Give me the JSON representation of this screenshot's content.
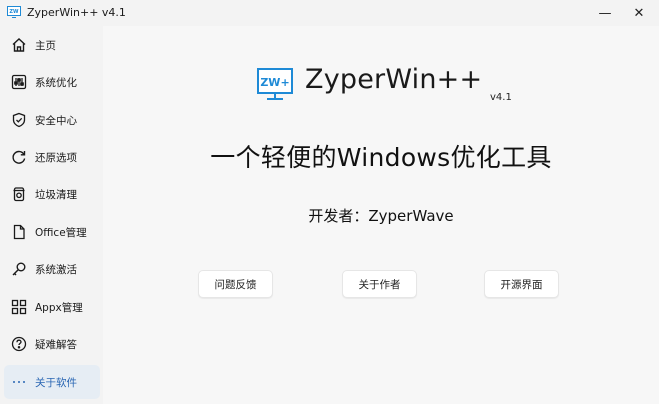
{
  "window": {
    "title": "ZyperWin++ v4.1",
    "minimize_glyph": "—",
    "close_glyph": "✕"
  },
  "sidebar": {
    "items": [
      {
        "label": "主页",
        "icon": "home-icon"
      },
      {
        "label": "系统优化",
        "icon": "sliders-icon"
      },
      {
        "label": "安全中心",
        "icon": "shield-check-icon"
      },
      {
        "label": "还原选项",
        "icon": "restore-icon"
      },
      {
        "label": "垃圾清理",
        "icon": "trash-icon"
      },
      {
        "label": "Office管理",
        "icon": "document-icon"
      },
      {
        "label": "系统激活",
        "icon": "key-icon"
      },
      {
        "label": "Appx管理",
        "icon": "apps-icon"
      },
      {
        "label": "疑难解答",
        "icon": "help-icon"
      },
      {
        "label": "关于软件",
        "icon": "more-icon",
        "selected": true
      }
    ]
  },
  "about": {
    "logo_text": "ZW+",
    "app_name": "ZyperWin++",
    "version": "v4.1",
    "tagline": "一个轻便的Windows优化工具",
    "developer": "开发者：ZyperWave",
    "buttons": {
      "feedback": "问题反馈",
      "author": "关于作者",
      "open_source": "开源界面"
    }
  },
  "colors": {
    "accent": "#2a66b3",
    "logo_blue": "#1e8ad6",
    "selected_bg": "#e6edf4"
  }
}
